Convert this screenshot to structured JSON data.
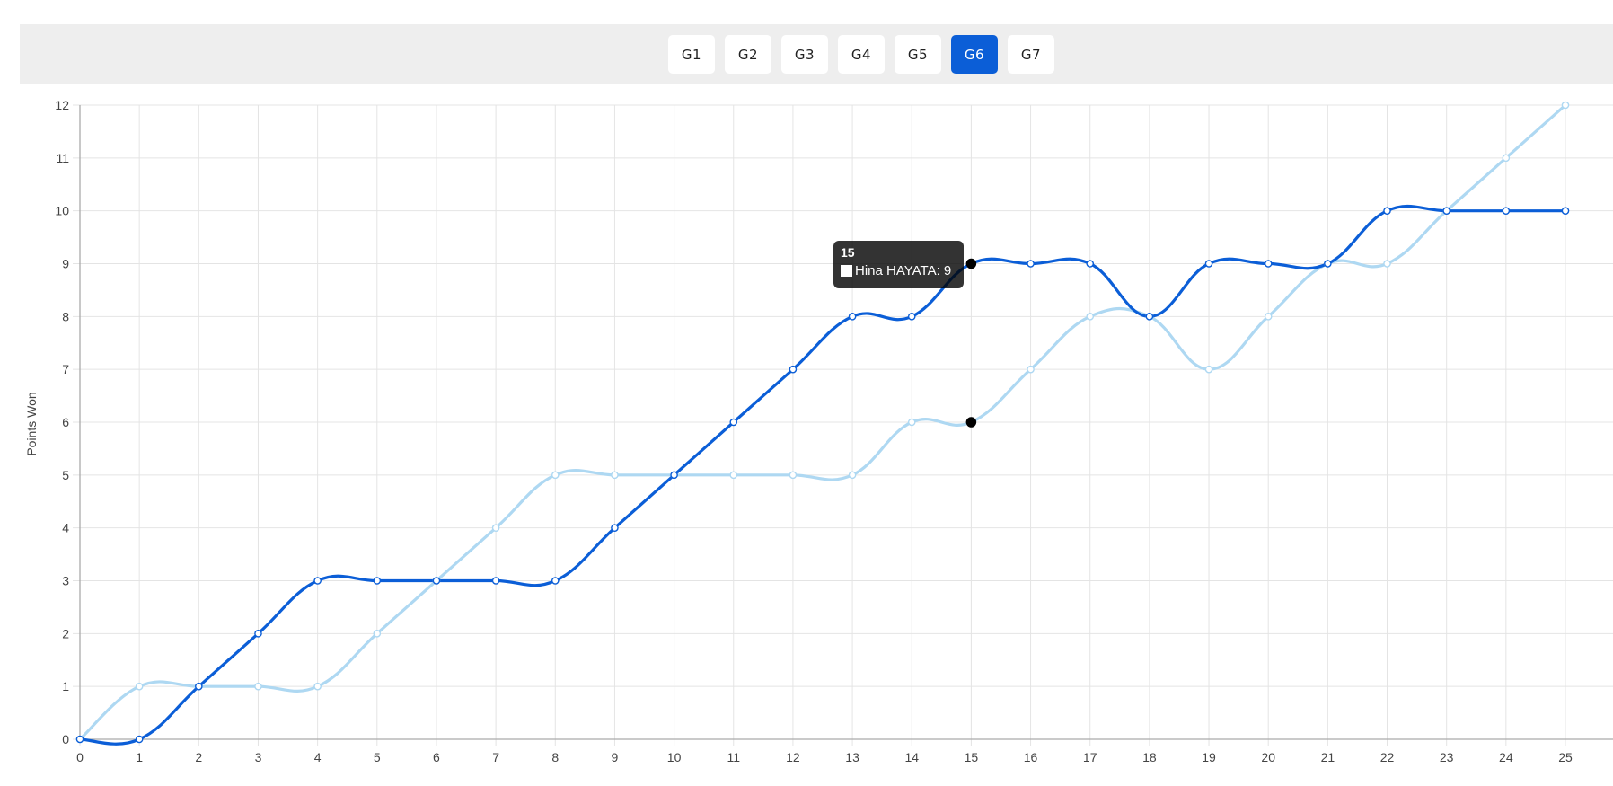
{
  "games": {
    "tabs": [
      "G1",
      "G2",
      "G3",
      "G4",
      "G5",
      "G6",
      "G7"
    ],
    "active": "G6"
  },
  "chart_data": {
    "type": "line",
    "ylabel": "Points Won",
    "xlabel": "",
    "x": [
      0,
      1,
      2,
      3,
      4,
      5,
      6,
      7,
      8,
      9,
      10,
      11,
      12,
      13,
      14,
      15,
      16,
      17,
      18,
      19,
      20,
      21,
      22,
      23,
      24,
      25
    ],
    "xlim": [
      0,
      25
    ],
    "ylim": [
      0,
      12
    ],
    "yticks": [
      0,
      1,
      2,
      3,
      4,
      5,
      6,
      7,
      8,
      9,
      10,
      11,
      12
    ],
    "grid": true,
    "legend": "none",
    "series": [
      {
        "name": "Hina HAYATA",
        "color": "#0b5ed7",
        "values": [
          0,
          0,
          1,
          2,
          3,
          3,
          3,
          3,
          3,
          4,
          5,
          6,
          7,
          8,
          8,
          9,
          9,
          9,
          8,
          9,
          9,
          9,
          10,
          10,
          10,
          10
        ]
      },
      {
        "name": "",
        "color": "#aed8f2",
        "values": [
          0,
          1,
          1,
          1,
          1,
          2,
          3,
          4,
          5,
          5,
          5,
          5,
          5,
          5,
          6,
          6,
          7,
          8,
          8,
          7,
          8,
          9,
          9,
          10,
          11,
          12
        ]
      }
    ],
    "tooltip": {
      "x": 15,
      "title": "15",
      "text": "Hina HAYATA: 9"
    }
  }
}
